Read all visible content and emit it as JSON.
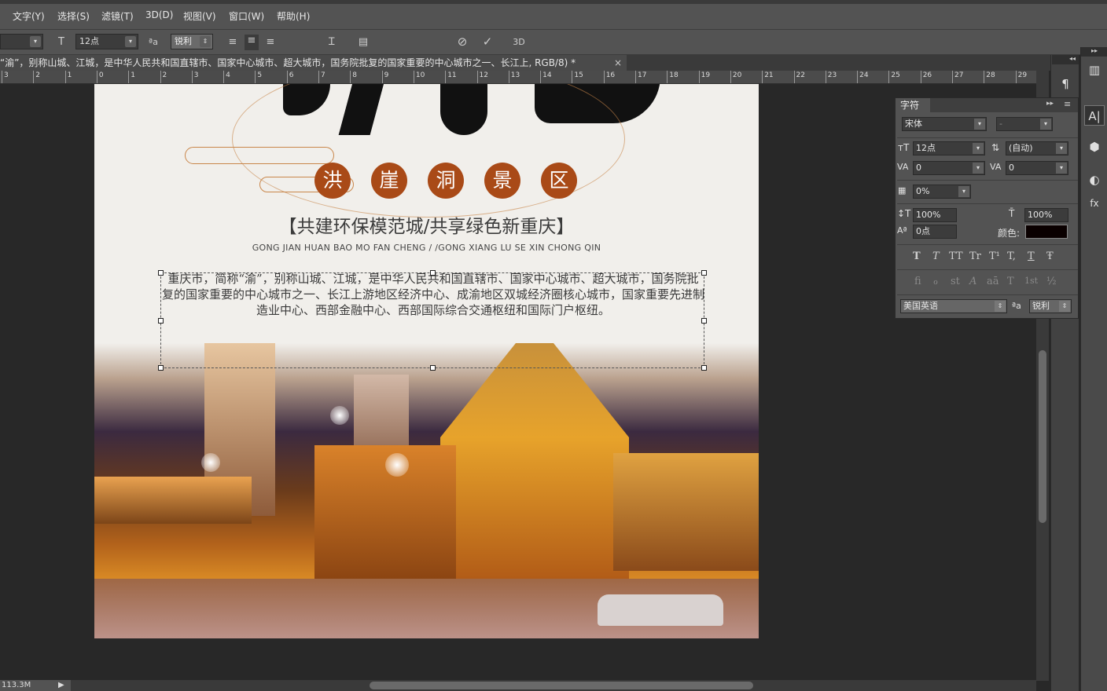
{
  "menu": [
    "文字(Y)",
    "选择(S)",
    "滤镜(T)",
    "3D(D)",
    "视图(V)",
    "窗口(W)",
    "帮助(H)"
  ],
  "options": {
    "font_size": "12点",
    "antialias": "锐利",
    "aa_icon": "ªa"
  },
  "document_tab": {
    "title": "“渝”，别称山城、江城，是中华人民共和国直辖市、国家中心城市、超大城市，国务院批复的国家重要的中心城市之一、长江上, RGB/8) *",
    "close": "×"
  },
  "ruler_ticks": [
    "3",
    "2",
    "1",
    "0",
    "1",
    "2",
    "3",
    "4",
    "5",
    "6",
    "7",
    "8",
    "9",
    "10",
    "11",
    "12",
    "13",
    "14",
    "15",
    "16",
    "17",
    "18",
    "19",
    "20",
    "21",
    "22",
    "23",
    "24",
    "25",
    "26",
    "27",
    "28",
    "29"
  ],
  "canvas": {
    "circle_chars": [
      "洪",
      "崖",
      "洞",
      "景",
      "区"
    ],
    "slogan": "【共建环保模范城/共享绿色新重庆】",
    "pinyin": "GONG JIAN HUAN BAO MO FAN CHENG / /GONG XIANG LU SE XIN CHONG QIN",
    "body": "重庆市，简称“渝”，别称山城、江城，是中华人民共和国直辖市、国家中心城市、超大城市，国务院批复的国家重要的中心城市之一、长江上游地区经济中心、成渝地区双城经济圈核心城市，国家重要先进制造业中心、西部金融中心、西部国际综合交通枢纽和国际门户枢纽。"
  },
  "status": {
    "doc_size": "113.3M",
    "arrow": "▶"
  },
  "char_panel": {
    "tab": "字符",
    "font_family": "宋体",
    "font_style": "-",
    "size": "12点",
    "leading": "(自动)",
    "kerning": "0",
    "tracking": "0",
    "scale_pct": "0%",
    "vscale": "100%",
    "hscale": "100%",
    "baseline": "0点",
    "color_label": "颜色:",
    "text_color": "#0a0000",
    "style_buttons": [
      "T",
      "T",
      "TT",
      "Tr",
      "T¹",
      "T,",
      "T",
      "Ŧ"
    ],
    "opentype_buttons": [
      "fi",
      "ℴ",
      "st",
      "A",
      "aā",
      "T",
      "1st",
      "½"
    ],
    "language": "美国英语",
    "antialias": "锐利",
    "aa_icon": "ªa"
  },
  "colors": {
    "chrome": "#535353",
    "circle": "#a94a17"
  }
}
